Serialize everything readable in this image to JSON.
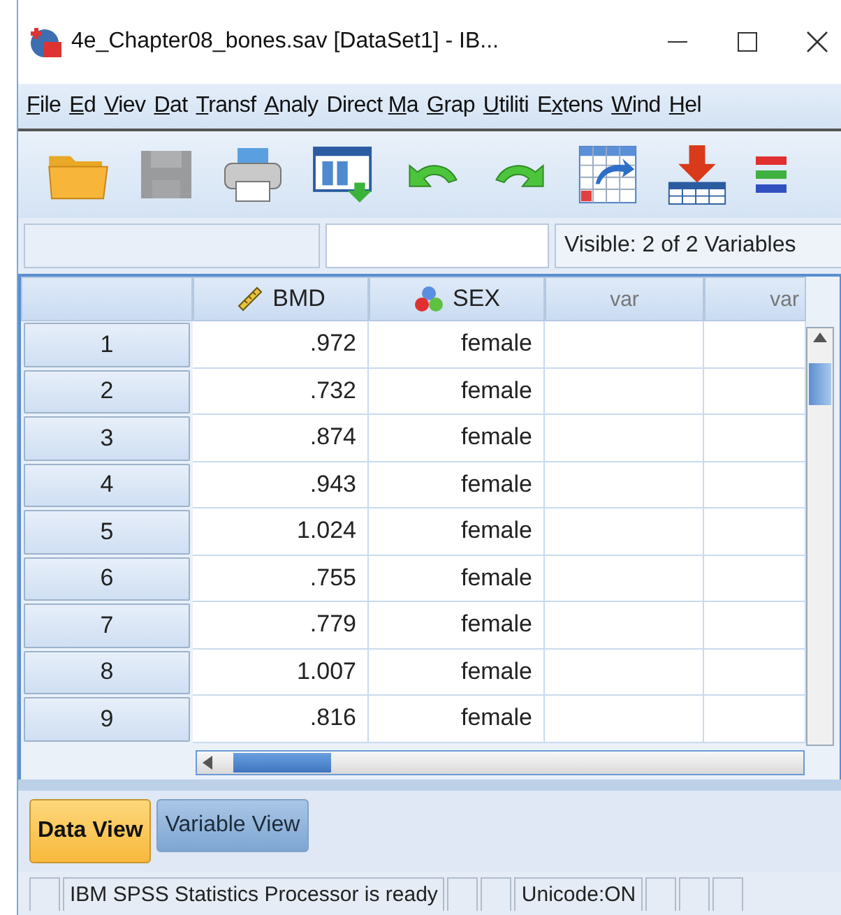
{
  "window": {
    "title": "4e_Chapter08_bones.sav [DataSet1] - IB..."
  },
  "menu": [
    {
      "parts": [
        {
          "text": "F",
          "underline": true
        },
        {
          "text": "ile",
          "underline": false
        }
      ]
    },
    {
      "parts": [
        {
          "text": "E",
          "underline": true
        },
        {
          "text": "d",
          "underline": false
        }
      ]
    },
    {
      "parts": [
        {
          "text": "V",
          "underline": true
        },
        {
          "text": "iev",
          "underline": false
        }
      ]
    },
    {
      "parts": [
        {
          "text": "D",
          "underline": true
        },
        {
          "text": "at",
          "underline": false
        }
      ]
    },
    {
      "parts": [
        {
          "text": "T",
          "underline": true
        },
        {
          "text": "ransf",
          "underline": false
        }
      ]
    },
    {
      "parts": [
        {
          "text": "A",
          "underline": true
        },
        {
          "text": "naly",
          "underline": false
        }
      ]
    },
    {
      "parts": [
        {
          "text": "Direct ",
          "underline": false
        },
        {
          "text": "M",
          "underline": true
        },
        {
          "text": "a",
          "underline": false
        }
      ]
    },
    {
      "parts": [
        {
          "text": "G",
          "underline": true
        },
        {
          "text": "rap",
          "underline": false
        }
      ]
    },
    {
      "parts": [
        {
          "text": "U",
          "underline": true
        },
        {
          "text": "tiliti",
          "underline": false
        }
      ]
    },
    {
      "parts": [
        {
          "text": "E",
          "underline": false
        },
        {
          "text": "x",
          "underline": true
        },
        {
          "text": "tens",
          "underline": false
        }
      ]
    },
    {
      "parts": [
        {
          "text": "W",
          "underline": true
        },
        {
          "text": "ind",
          "underline": false
        }
      ]
    },
    {
      "parts": [
        {
          "text": "H",
          "underline": true
        },
        {
          "text": "el",
          "underline": false
        }
      ]
    }
  ],
  "toolbar": [
    {
      "kind": "open",
      "disabled": false
    },
    {
      "kind": "save",
      "disabled": true
    },
    {
      "kind": "print",
      "disabled": false
    },
    {
      "kind": "recall",
      "disabled": false
    },
    {
      "kind": "undo",
      "disabled": false
    },
    {
      "kind": "redo",
      "disabled": false
    },
    {
      "kind": "goto",
      "disabled": false
    },
    {
      "kind": "insert",
      "disabled": false
    },
    {
      "kind": "variables",
      "disabled": false
    }
  ],
  "visible_label": "Visible: 2 of 2 Variables",
  "table": {
    "columns": [
      {
        "name": "BMD",
        "kind": "scale"
      },
      {
        "name": "SEX",
        "kind": "nominal"
      },
      {
        "name": "var",
        "kind": "empty"
      },
      {
        "name": "var",
        "kind": "empty"
      }
    ],
    "rows": [
      {
        "index": "1",
        "cells": [
          ".972",
          "female"
        ]
      },
      {
        "index": "2",
        "cells": [
          ".732",
          "female"
        ]
      },
      {
        "index": "3",
        "cells": [
          ".874",
          "female"
        ]
      },
      {
        "index": "4",
        "cells": [
          ".943",
          "female"
        ]
      },
      {
        "index": "5",
        "cells": [
          "1.024",
          "female"
        ]
      },
      {
        "index": "6",
        "cells": [
          ".755",
          "female"
        ]
      },
      {
        "index": "7",
        "cells": [
          ".779",
          "female"
        ]
      },
      {
        "index": "8",
        "cells": [
          "1.007",
          "female"
        ]
      },
      {
        "index": "9",
        "cells": [
          ".816",
          "female"
        ]
      }
    ]
  },
  "tabs": [
    {
      "label": "Data View",
      "selected": true
    },
    {
      "label": "Variable View",
      "selected": false
    }
  ],
  "status_bar": [
    "IBM SPSS Statistics Processor is ready",
    "Unicode:ON"
  ]
}
